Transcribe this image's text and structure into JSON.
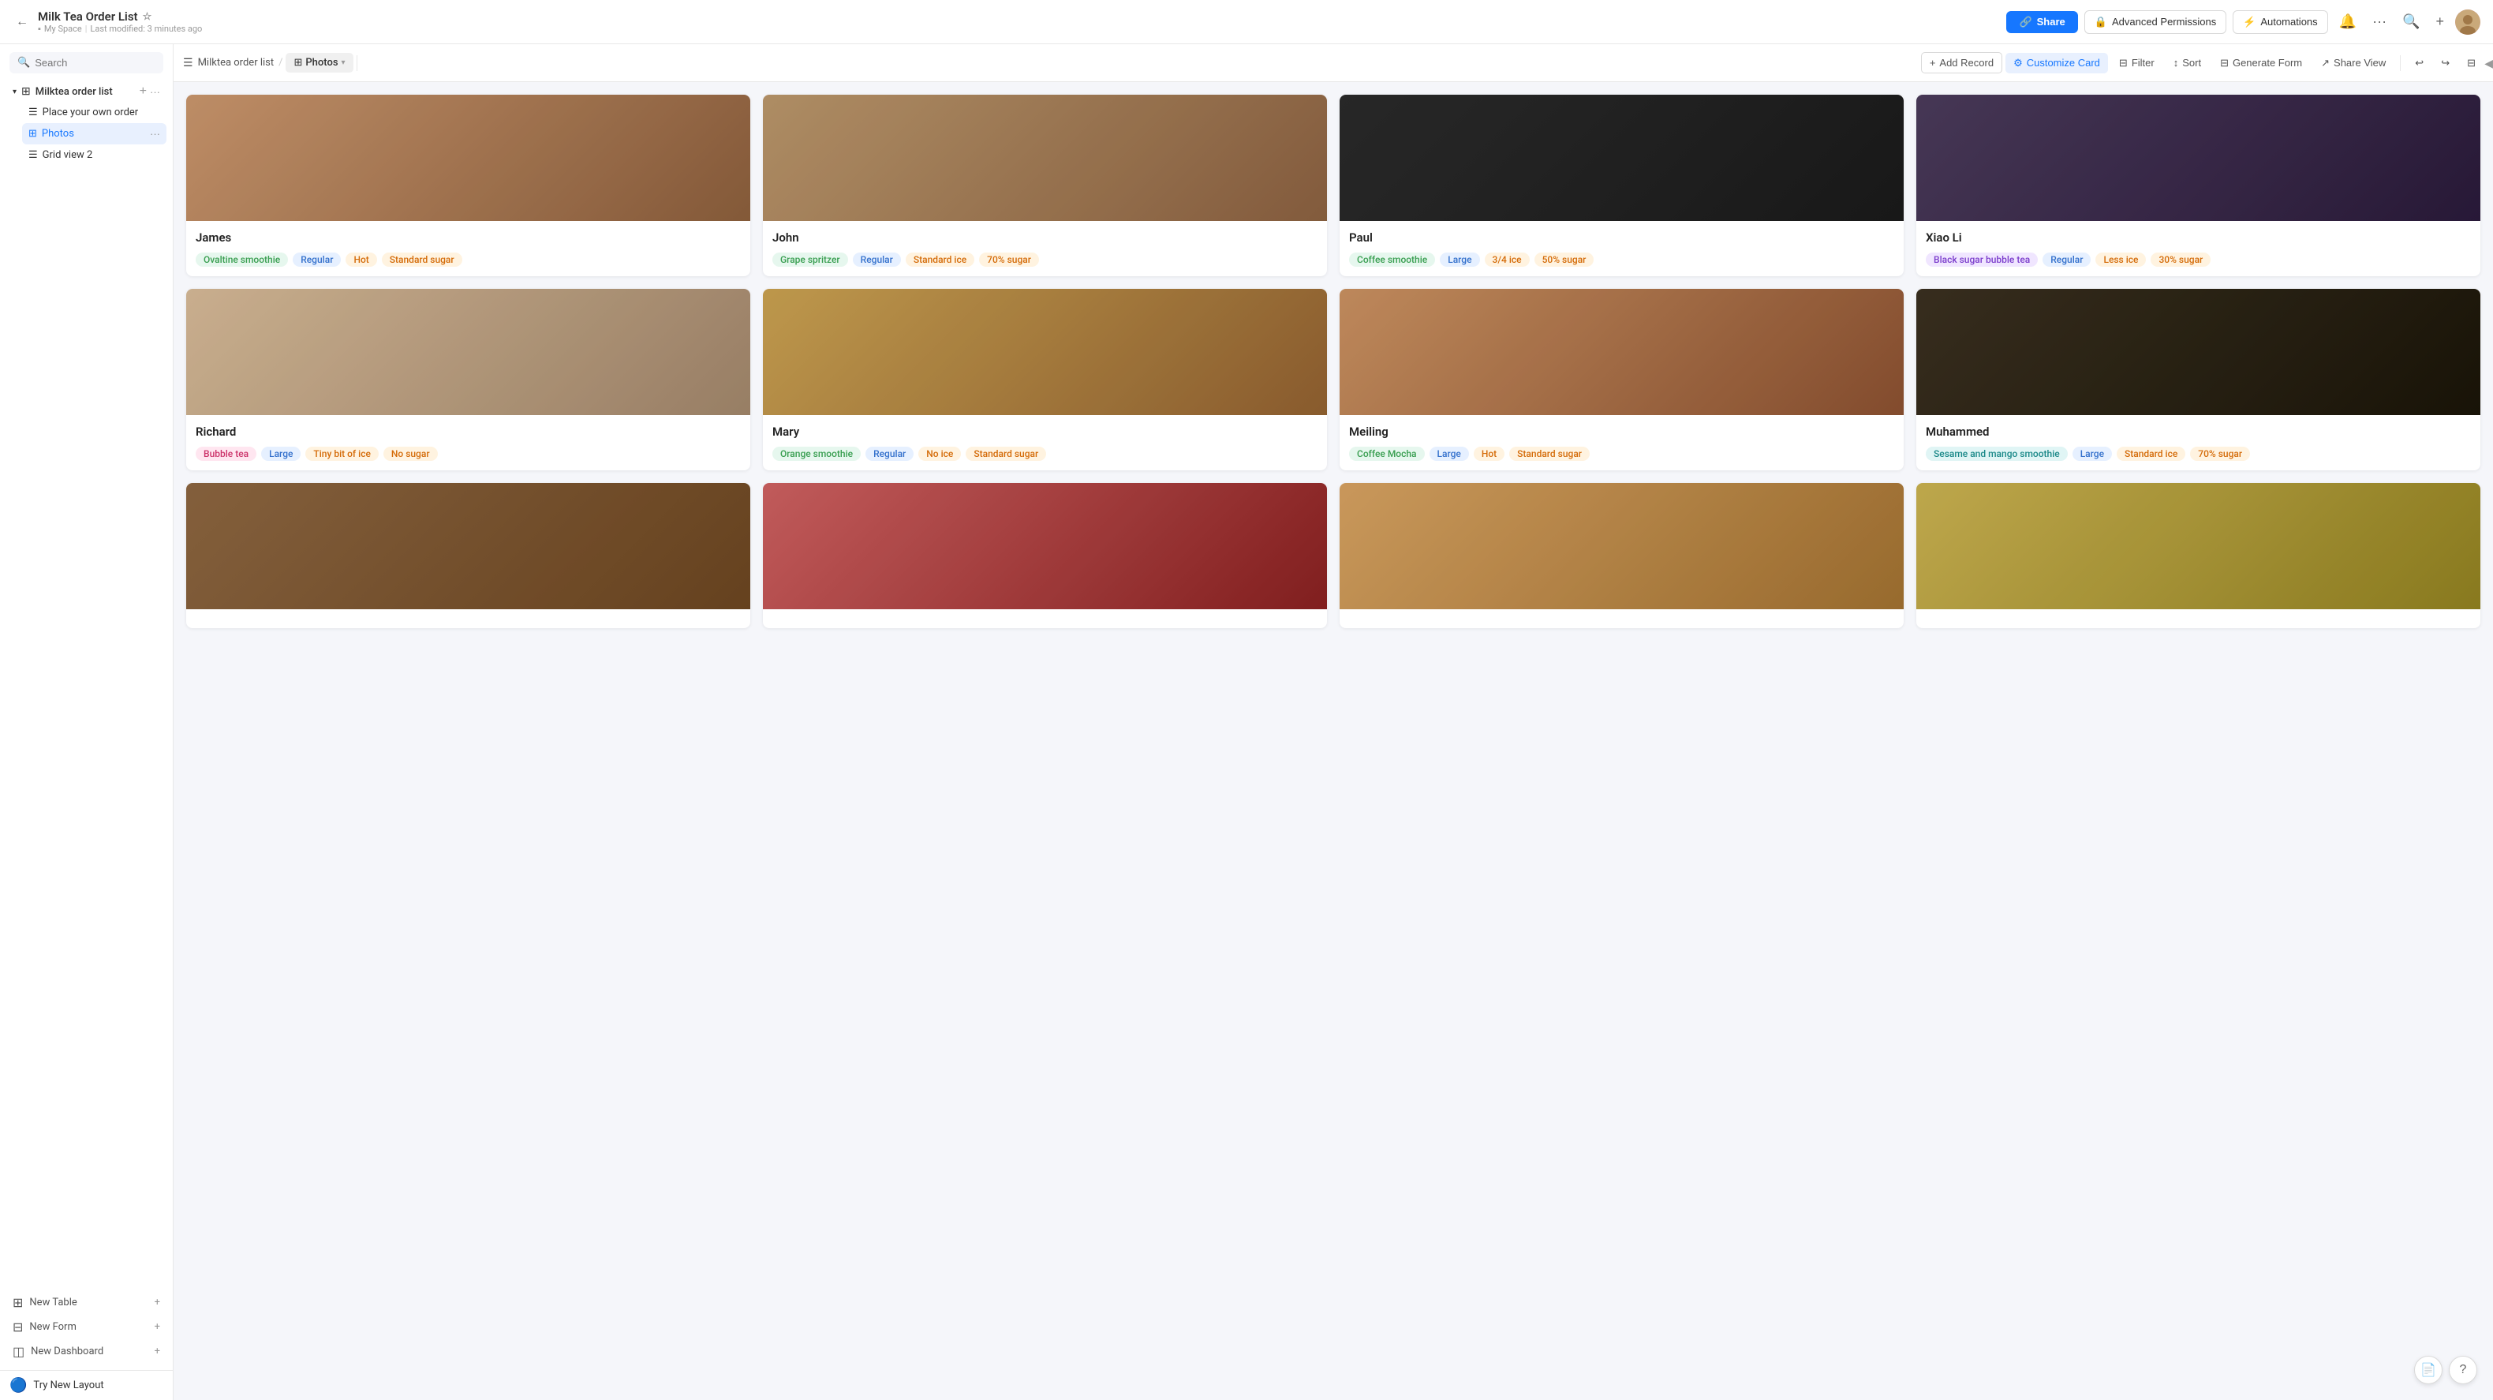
{
  "topbar": {
    "back_icon": "←",
    "title": "Milk Tea Order List",
    "star_icon": "☆",
    "workspace": "My Space",
    "last_modified": "Last modified: 3 minutes ago",
    "share_label": "Share",
    "share_icon": "🔗",
    "adv_permissions_label": "Advanced Permissions",
    "adv_permissions_icon": "🔒",
    "automations_label": "Automations",
    "automations_icon": "⚡",
    "bell_icon": "🔔",
    "more_icon": "···",
    "search_icon": "🔍",
    "plus_icon": "+"
  },
  "sidebar": {
    "search_placeholder": "Search",
    "collapse_icon": "◀",
    "tree": {
      "group_name": "Milktea order list",
      "add_icon": "+",
      "more_icon": "···",
      "items": [
        {
          "id": "place-order",
          "label": "Place your own order",
          "icon": "☰",
          "active": false
        },
        {
          "id": "photos",
          "label": "Photos",
          "icon": "⊞",
          "active": true
        },
        {
          "id": "grid-view-2",
          "label": "Grid view 2",
          "icon": "☰",
          "active": false
        }
      ]
    },
    "new_table_label": "New Table",
    "new_form_label": "New Form",
    "new_dashboard_label": "New Dashboard",
    "try_new_layout_label": "Try New Layout"
  },
  "toolbar": {
    "breadcrumb_table": "Milktea order list",
    "tab_photos": "Photos",
    "tab_photos_icon": "⊞",
    "tab_chevron": "▾",
    "add_record_label": "Add Record",
    "customize_card_label": "Customize Card",
    "filter_label": "Filter",
    "sort_label": "Sort",
    "generate_form_label": "Generate Form",
    "share_view_label": "Share View",
    "undo_icon": "↩",
    "redo_icon": "↪",
    "search_records_icon": "⊟"
  },
  "cards": [
    {
      "id": "james",
      "name": "James",
      "image_class": "img-james",
      "tags": [
        {
          "label": "Ovaltine smoothie",
          "color": "tag-green"
        },
        {
          "label": "Regular",
          "color": "tag-blue"
        },
        {
          "label": "Hot",
          "color": "tag-orange"
        },
        {
          "label": "Standard sugar",
          "color": "tag-orange"
        }
      ]
    },
    {
      "id": "john",
      "name": "John",
      "image_class": "img-john",
      "tags": [
        {
          "label": "Grape spritzer",
          "color": "tag-green"
        },
        {
          "label": "Regular",
          "color": "tag-blue"
        },
        {
          "label": "Standard ice",
          "color": "tag-orange"
        },
        {
          "label": "70% sugar",
          "color": "tag-orange"
        }
      ]
    },
    {
      "id": "paul",
      "name": "Paul",
      "image_class": "img-paul",
      "tags": [
        {
          "label": "Coffee smoothie",
          "color": "tag-green"
        },
        {
          "label": "Large",
          "color": "tag-blue"
        },
        {
          "label": "3/4 ice",
          "color": "tag-orange"
        },
        {
          "label": "50% sugar",
          "color": "tag-orange"
        }
      ]
    },
    {
      "id": "xiao-li",
      "name": "Xiao Li",
      "image_class": "img-xiao",
      "tags": [
        {
          "label": "Black sugar bubble tea",
          "color": "tag-purple"
        },
        {
          "label": "Regular",
          "color": "tag-blue"
        },
        {
          "label": "Less ice",
          "color": "tag-orange"
        },
        {
          "label": "30% sugar",
          "color": "tag-orange"
        }
      ]
    },
    {
      "id": "richard",
      "name": "Richard",
      "image_class": "img-richard",
      "tags": [
        {
          "label": "Bubble tea",
          "color": "tag-pink"
        },
        {
          "label": "Large",
          "color": "tag-blue"
        },
        {
          "label": "Tiny bit of ice",
          "color": "tag-orange"
        },
        {
          "label": "No sugar",
          "color": "tag-orange"
        }
      ]
    },
    {
      "id": "mary",
      "name": "Mary",
      "image_class": "img-mary",
      "tags": [
        {
          "label": "Orange smoothie",
          "color": "tag-green"
        },
        {
          "label": "Regular",
          "color": "tag-blue"
        },
        {
          "label": "No ice",
          "color": "tag-orange"
        },
        {
          "label": "Standard sugar",
          "color": "tag-orange"
        }
      ]
    },
    {
      "id": "meiling",
      "name": "Meiling",
      "image_class": "img-meiling",
      "tags": [
        {
          "label": "Coffee Mocha",
          "color": "tag-green"
        },
        {
          "label": "Large",
          "color": "tag-blue"
        },
        {
          "label": "Hot",
          "color": "tag-orange"
        },
        {
          "label": "Standard sugar",
          "color": "tag-orange"
        }
      ]
    },
    {
      "id": "muhammed",
      "name": "Muhammed",
      "image_class": "img-muhammed",
      "tags": [
        {
          "label": "Sesame and mango smoothie",
          "color": "tag-teal"
        },
        {
          "label": "Large",
          "color": "tag-blue"
        },
        {
          "label": "Standard ice",
          "color": "tag-orange"
        },
        {
          "label": "70% sugar",
          "color": "tag-orange"
        }
      ]
    },
    {
      "id": "row3a",
      "name": "",
      "image_class": "img-row3a",
      "tags": []
    },
    {
      "id": "row3b",
      "name": "",
      "image_class": "img-row3b",
      "tags": []
    },
    {
      "id": "row3c",
      "name": "",
      "image_class": "img-row3c",
      "tags": []
    },
    {
      "id": "row3d",
      "name": "",
      "image_class": "img-row3d",
      "tags": []
    }
  ]
}
